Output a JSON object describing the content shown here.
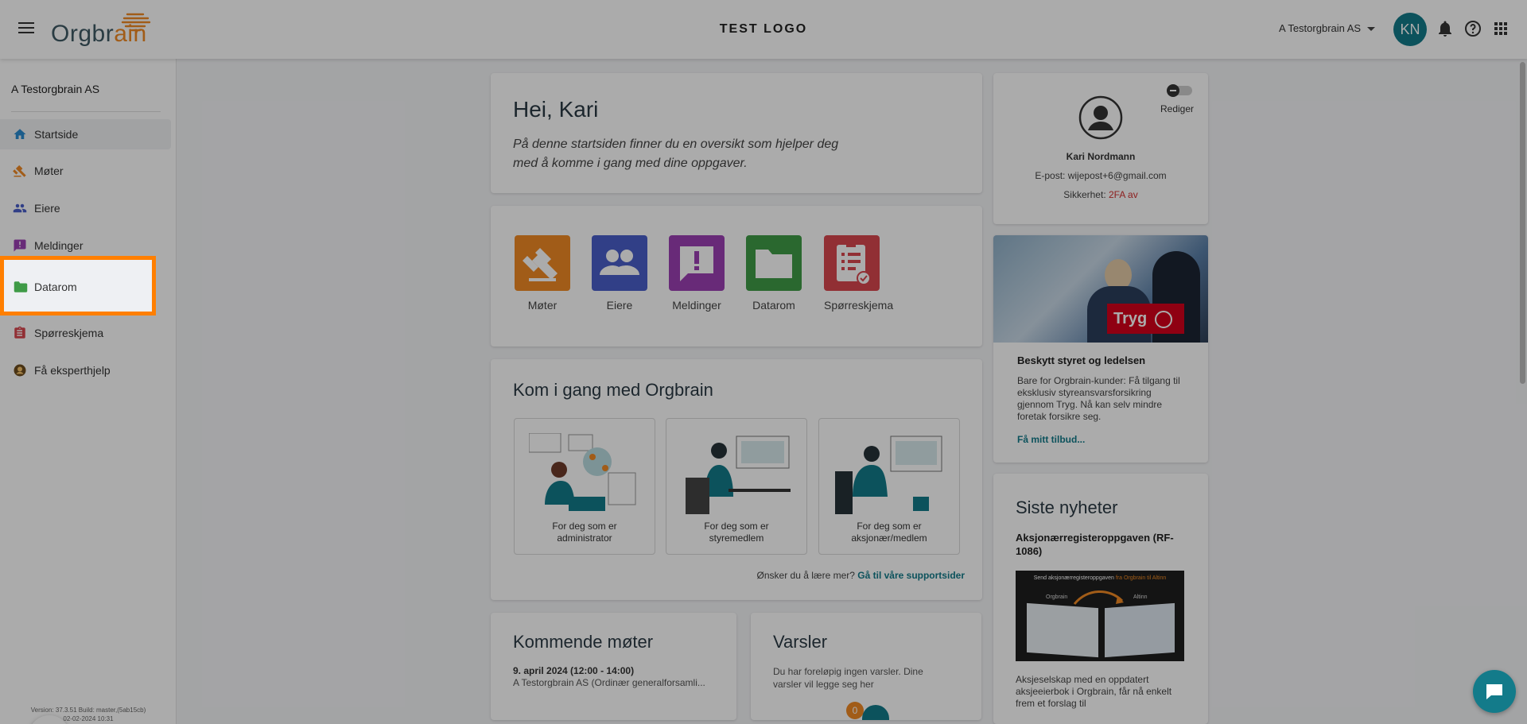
{
  "header": {
    "logo_text_a": "Orgbr",
    "logo_text_b": "ain",
    "center_title": "TEST LOGO",
    "org_selector": "A Testorgbrain AS",
    "avatar_initials": "KN",
    "icons": [
      "menu-icon",
      "bell-icon",
      "help-icon",
      "apps-grid-icon"
    ]
  },
  "sidebar": {
    "org_name": "A Testorgbrain AS",
    "items": [
      {
        "label": "Startside",
        "icon": "home-icon"
      },
      {
        "label": "Møter",
        "icon": "gavel-icon"
      },
      {
        "label": "Eiere",
        "icon": "people-icon"
      },
      {
        "label": "Meldinger",
        "icon": "message-icon"
      },
      {
        "label": "Datarom",
        "icon": "folder-icon"
      },
      {
        "label": "Spørreskjema",
        "icon": "clipboard-icon"
      },
      {
        "label": "Få eksperthjelp",
        "icon": "expert-help-icon"
      }
    ],
    "version_line1": "Version: 37.3.51 Build: master,(5ab15cb)",
    "version_line2": "02-02-2024 10:31"
  },
  "welcome": {
    "title": "Hei, Kari",
    "subtitle_line1": "På denne startsiden finner du en oversikt som hjelper deg",
    "subtitle_line2": "med å komme i gang med dine oppgaver."
  },
  "quick_tiles": [
    {
      "label": "Møter",
      "color": "#f08a24"
    },
    {
      "label": "Eiere",
      "color": "#4a5fc9"
    },
    {
      "label": "Meldinger",
      "color": "#9b3fb3"
    },
    {
      "label": "Datarom",
      "color": "#3f9b47"
    },
    {
      "label": "Spørreskjema",
      "color": "#d9464e"
    }
  ],
  "getting_started": {
    "title": "Kom i gang med Orgbrain",
    "cards": [
      {
        "line1": "For deg som er",
        "line2": "administrator"
      },
      {
        "line1": "For deg som er",
        "line2": "styremedlem"
      },
      {
        "line1": "For deg som er",
        "line2": "aksjonær/medlem"
      }
    ],
    "footer_text": "Ønsker du å lære mer?",
    "footer_link": "Gå til våre supportsider"
  },
  "meetings": {
    "title": "Kommende møter",
    "date": "9. april 2024 (12:00 - 14:00)",
    "desc": "A Testorgbrain AS (Ordinær generalforsamli..."
  },
  "alerts": {
    "title": "Varsler",
    "text_line1": "Du har foreløpig ingen varsler. Dine",
    "text_line2": "varsler vil legge seg her",
    "badge": "0"
  },
  "profile": {
    "edit_label": "Rediger",
    "name": "Kari Nordmann",
    "email_label": "E-post:",
    "email": "wijepost+6@gmail.com",
    "security_label": "Sikkerhet:",
    "security_value": "2FA av",
    "security_color": "#d32f2f"
  },
  "ad": {
    "brand": "Tryg",
    "title": "Beskytt styret og ledelsen",
    "body_line1": "Bare for Orgbrain-kunder: Få tilgang til",
    "body_line2": "eksklusiv styreansvarsforsikring",
    "body_line3": "gjennom Tryg. Nå kan selv mindre",
    "body_line4": "foretak forsikre seg.",
    "link": "Få mitt tilbud..."
  },
  "news": {
    "title": "Siste nyheter",
    "headline_line1": "Aksjonærregisteroppgaven (RF-",
    "headline_line2": "1086)",
    "banner_a": "Send aksjonærregisteroppgaven",
    "banner_b": "fra Orgbrain til Altinn",
    "banner_left": "Orgbrain",
    "banner_right": "Altinn",
    "body_line1": "Aksjeselskap med en oppdatert",
    "body_line2": "aksjeeierbok i Orgbrain, får nå enkelt",
    "body_line3": "frem et forslag til"
  },
  "colors": {
    "accent": "#137b8a",
    "highlight": "#ff7f00",
    "brand_orange": "#f08a24"
  }
}
